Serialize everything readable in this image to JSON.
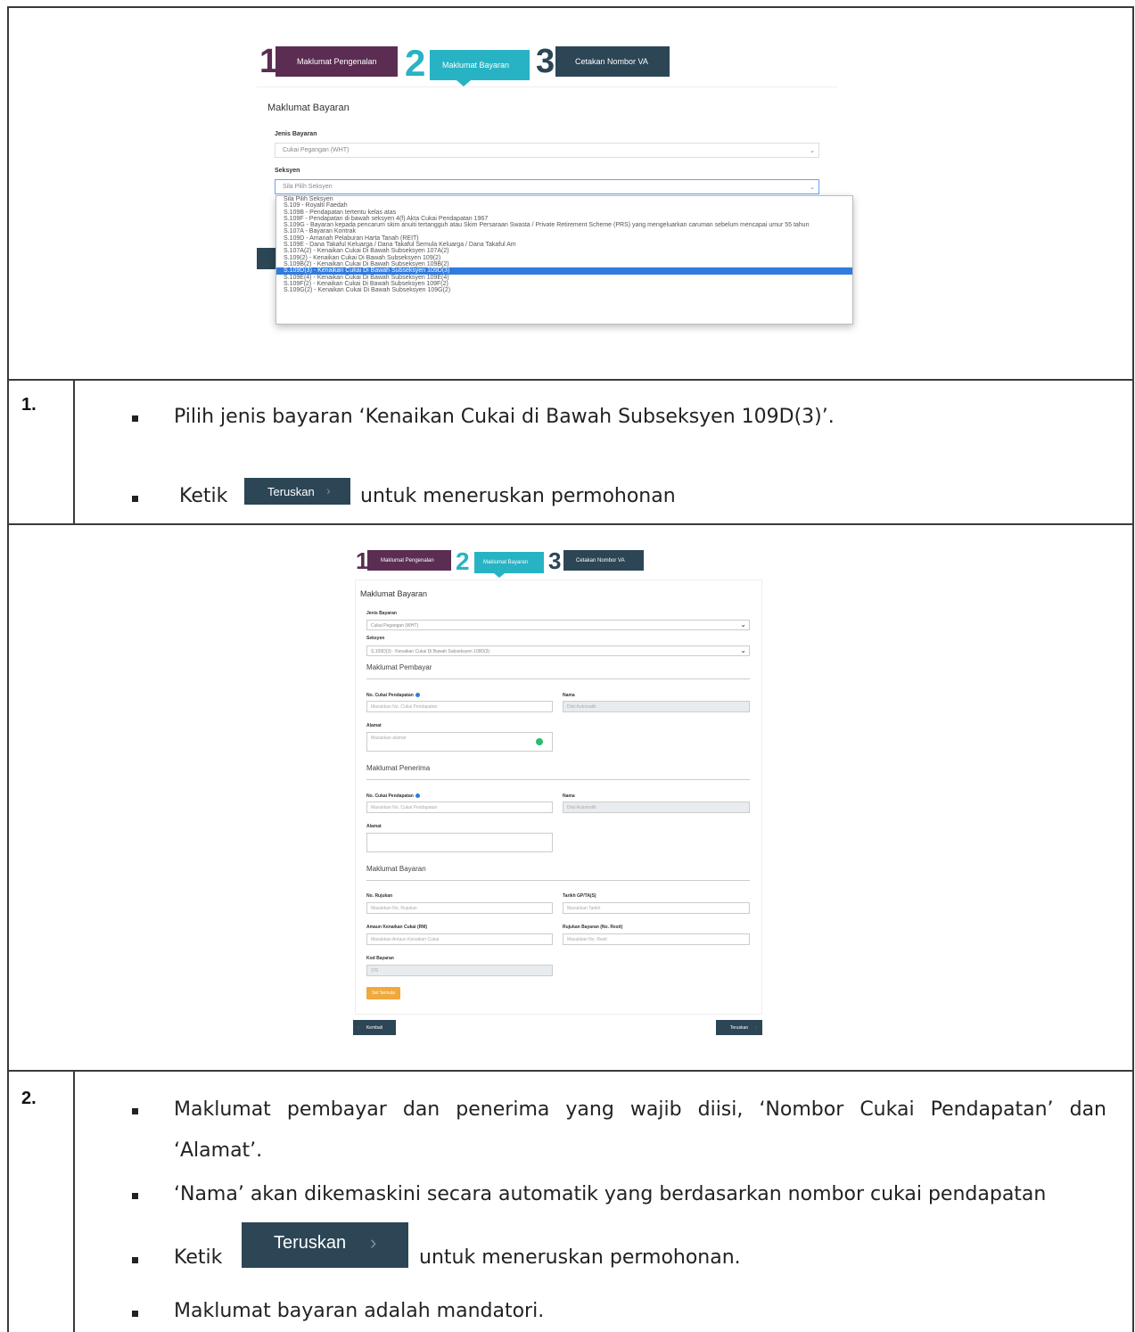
{
  "wizard": {
    "steps": [
      {
        "number": "1",
        "label": "Maklumat Pengenalan",
        "color": "#5b2d52"
      },
      {
        "number": "2",
        "label": "Maklumat Bayaran",
        "color": "#28b3c4"
      },
      {
        "number": "3",
        "label": "Cetakan Nombor VA",
        "color": "#2c4656"
      }
    ]
  },
  "screen1": {
    "title": "Maklumat Bayaran",
    "jenis_label": "Jenis Bayaran",
    "jenis_value": "Cukai Pegangan (WHT)",
    "seksyen_label": "Seksyen",
    "seksyen_value": "Sila Pilih Seksyen",
    "options": [
      "Sila Pilih Seksyen",
      "S.109 - Royalti Faedah",
      "S.109B - Pendapatan tertentu kelas atas",
      "S.109F - Pendapatan di bawah seksyen 4(f) Akta Cukai Pendapatan 1967",
      "S.109G - Bayaran kepada pencarum skim anuiti tertangguh atau Skim Persaraan Swasta / Private Retirement Scheme (PRS) yang mengeluarkan caruman sebelum mencapai umur 55 tahun",
      "S.107A - Bayaran Kontrak",
      "S.109D - Amanah Pelaburan Harta Tanah (REIT)",
      "S.109E - Dana Takaful Keluarga / Dana Takaful Semula Keluarga / Dana Takaful Am",
      "S.107A(2) - Kenaikan Cukai Di Bawah Subseksyen 107A(2)",
      "S.109(2) - Kenaikan Cukai Di Bawah Subseksyen 109(2)",
      "S.109B(2) - Kenaikan Cukai Di Bawah Subseksyen 109B(2)",
      "S.109D(3) - Kenaikan Cukai Di Bawah Subseksyen 109D(3)",
      "S.109E(4) - Kenaikan Cukai Di Bawah Subseksyen 109E(4)",
      "S.109F(2) - Kenaikan Cukai Di Bawah Subseksyen 109F(2)",
      "S.109G(2) - Kenaikan Cukai Di Bawah Subseksyen 109G(2)"
    ],
    "selected_index": 11,
    "highlight_color": "#2f7be0"
  },
  "step1": {
    "number": "1.",
    "bullet1": "Pilih jenis bayaran ‘Kenaikan Cukai di Bawah Subseksyen 109D(3)’.",
    "bullet2_pre": "Ketik",
    "bullet2_button": "Teruskan",
    "bullet2_post": "untuk meneruskan permohonan"
  },
  "screen2": {
    "title": "Maklumat Bayaran",
    "jenis_label": "Jenis Bayaran",
    "jenis_value": "Cukai Pegangan (WHT)",
    "seksyen_label": "Seksyen",
    "seksyen_value": "S.109D(3) - Kenaikan Cukai Di Bawah Subseksyen 109D(3)",
    "pembayar_heading": "Maklumat Pembayar",
    "penerima_heading": "Maklumat Penerima",
    "bayaran_heading": "Maklumat Bayaran",
    "no_cukai_label": "No. Cukai Pendapatan",
    "no_cukai_placeholder": "Masukkan No. Cukai Pendapatan",
    "nama_label": "Nama",
    "nama_placeholder": "Diisi Automatik",
    "alamat_label": "Alamat",
    "alamat_placeholder": "Masukkan alamat",
    "no_rujukan_label": "No. Rujukan",
    "no_rujukan_placeholder": "Masukkan No. Rujukan",
    "tarikh_label": "Tarikh GP/TA(S)",
    "tarikh_placeholder": "Masukkan Tarikh",
    "amaun_label": "Amaun Kenaikan Cukai (RM)",
    "amaun_placeholder": "Masukkan Amaun Kenaikan Cukai",
    "rujukan_label": "Rujukan Bayaran (No. Resit)",
    "rujukan_placeholder": "Masukkan No. Resit",
    "kod_label": "Kod Bayaran",
    "kod_value": "370",
    "simpan_label": "Set Semula",
    "kembali_label": "Kembali",
    "teruskan_label": "Teruskan"
  },
  "step2": {
    "number": "2.",
    "bullet1_line1": "Maklumat pembayar dan penerima yang wajib diisi, ‘Nombor Cukai Pendapatan’ dan",
    "bullet1_line2": "‘Alamat’.",
    "bullet2": "‘Nama’ akan dikemaskini secara automatik yang berdasarkan nombor cukai pendapatan",
    "bullet3_pre": "Ketik",
    "bullet3_button": "Teruskan",
    "bullet3_post": "untuk meneruskan permohonan.",
    "bullet4": "Maklumat bayaran adalah mandatori."
  }
}
